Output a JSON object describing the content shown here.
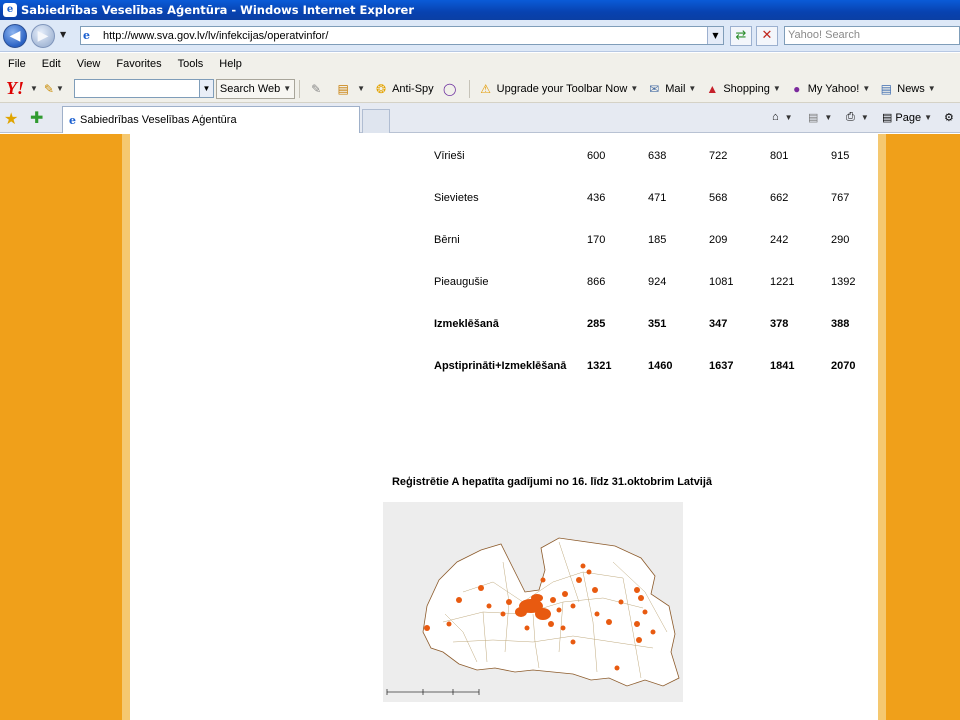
{
  "window": {
    "title": "Sabiedrības Veselības Aģentūra - Windows Internet Explorer"
  },
  "address_bar": {
    "url": "http://www.sva.gov.lv/lv/infekcijas/operatvinfor/",
    "search_placeholder": "Yahoo! Search"
  },
  "menu": [
    "File",
    "Edit",
    "View",
    "Favorites",
    "Tools",
    "Help"
  ],
  "yahoo_toolbar": {
    "search_label": "Search Web",
    "anti_spy": "Anti-Spy",
    "upgrade": "Upgrade your Toolbar Now",
    "mail": "Mail",
    "shopping": "Shopping",
    "my_yahoo": "My Yahoo!",
    "news": "News"
  },
  "tab": {
    "title": "Sabiedrības Veselības Aģentūra"
  },
  "command_bar": {
    "page": "Page"
  },
  "stats_table": {
    "rows": [
      {
        "label": "Vīrieši",
        "values": [
          "600",
          "638",
          "722",
          "801",
          "915"
        ],
        "bold": false
      },
      {
        "label": "Sievietes",
        "values": [
          "436",
          "471",
          "568",
          "662",
          "767"
        ],
        "bold": false
      },
      {
        "label": "Bērni",
        "values": [
          "170",
          "185",
          "209",
          "242",
          "290"
        ],
        "bold": false
      },
      {
        "label": "Pieaugušie",
        "values": [
          "866",
          "924",
          "1081",
          "1221",
          "1392"
        ],
        "bold": false
      },
      {
        "label": "Izmeklēšanā",
        "values": [
          "285",
          "351",
          "347",
          "378",
          "388"
        ],
        "bold": true
      },
      {
        "label": "Apstiprināti+Izmeklēšanā",
        "values": [
          "1321",
          "1460",
          "1637",
          "1841",
          "2070"
        ],
        "bold": true
      }
    ]
  },
  "map": {
    "caption": "Reģistrētie A hepatīta gadījumi no 16. līdz 31.oktobrim Latvijā",
    "case_color": "#e85a10",
    "road_color": "#b8a070"
  }
}
